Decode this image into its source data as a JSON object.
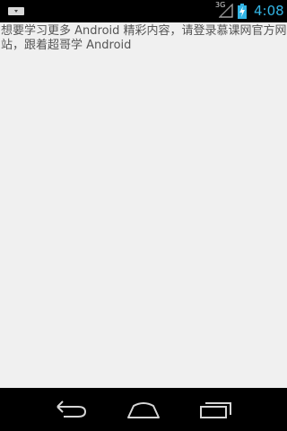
{
  "status_bar": {
    "time": "4:08",
    "network_type": "3G",
    "icons": [
      "notification-icon",
      "signal-icon",
      "battery-charging-icon"
    ],
    "clock_color": "#33b5e5"
  },
  "main": {
    "text": "想要学习更多 Android 精彩内容，请登录慕课网官方网站，跟着超哥学 Android"
  },
  "nav_bar": {
    "buttons": [
      "back-icon",
      "home-icon",
      "recents-icon"
    ]
  }
}
